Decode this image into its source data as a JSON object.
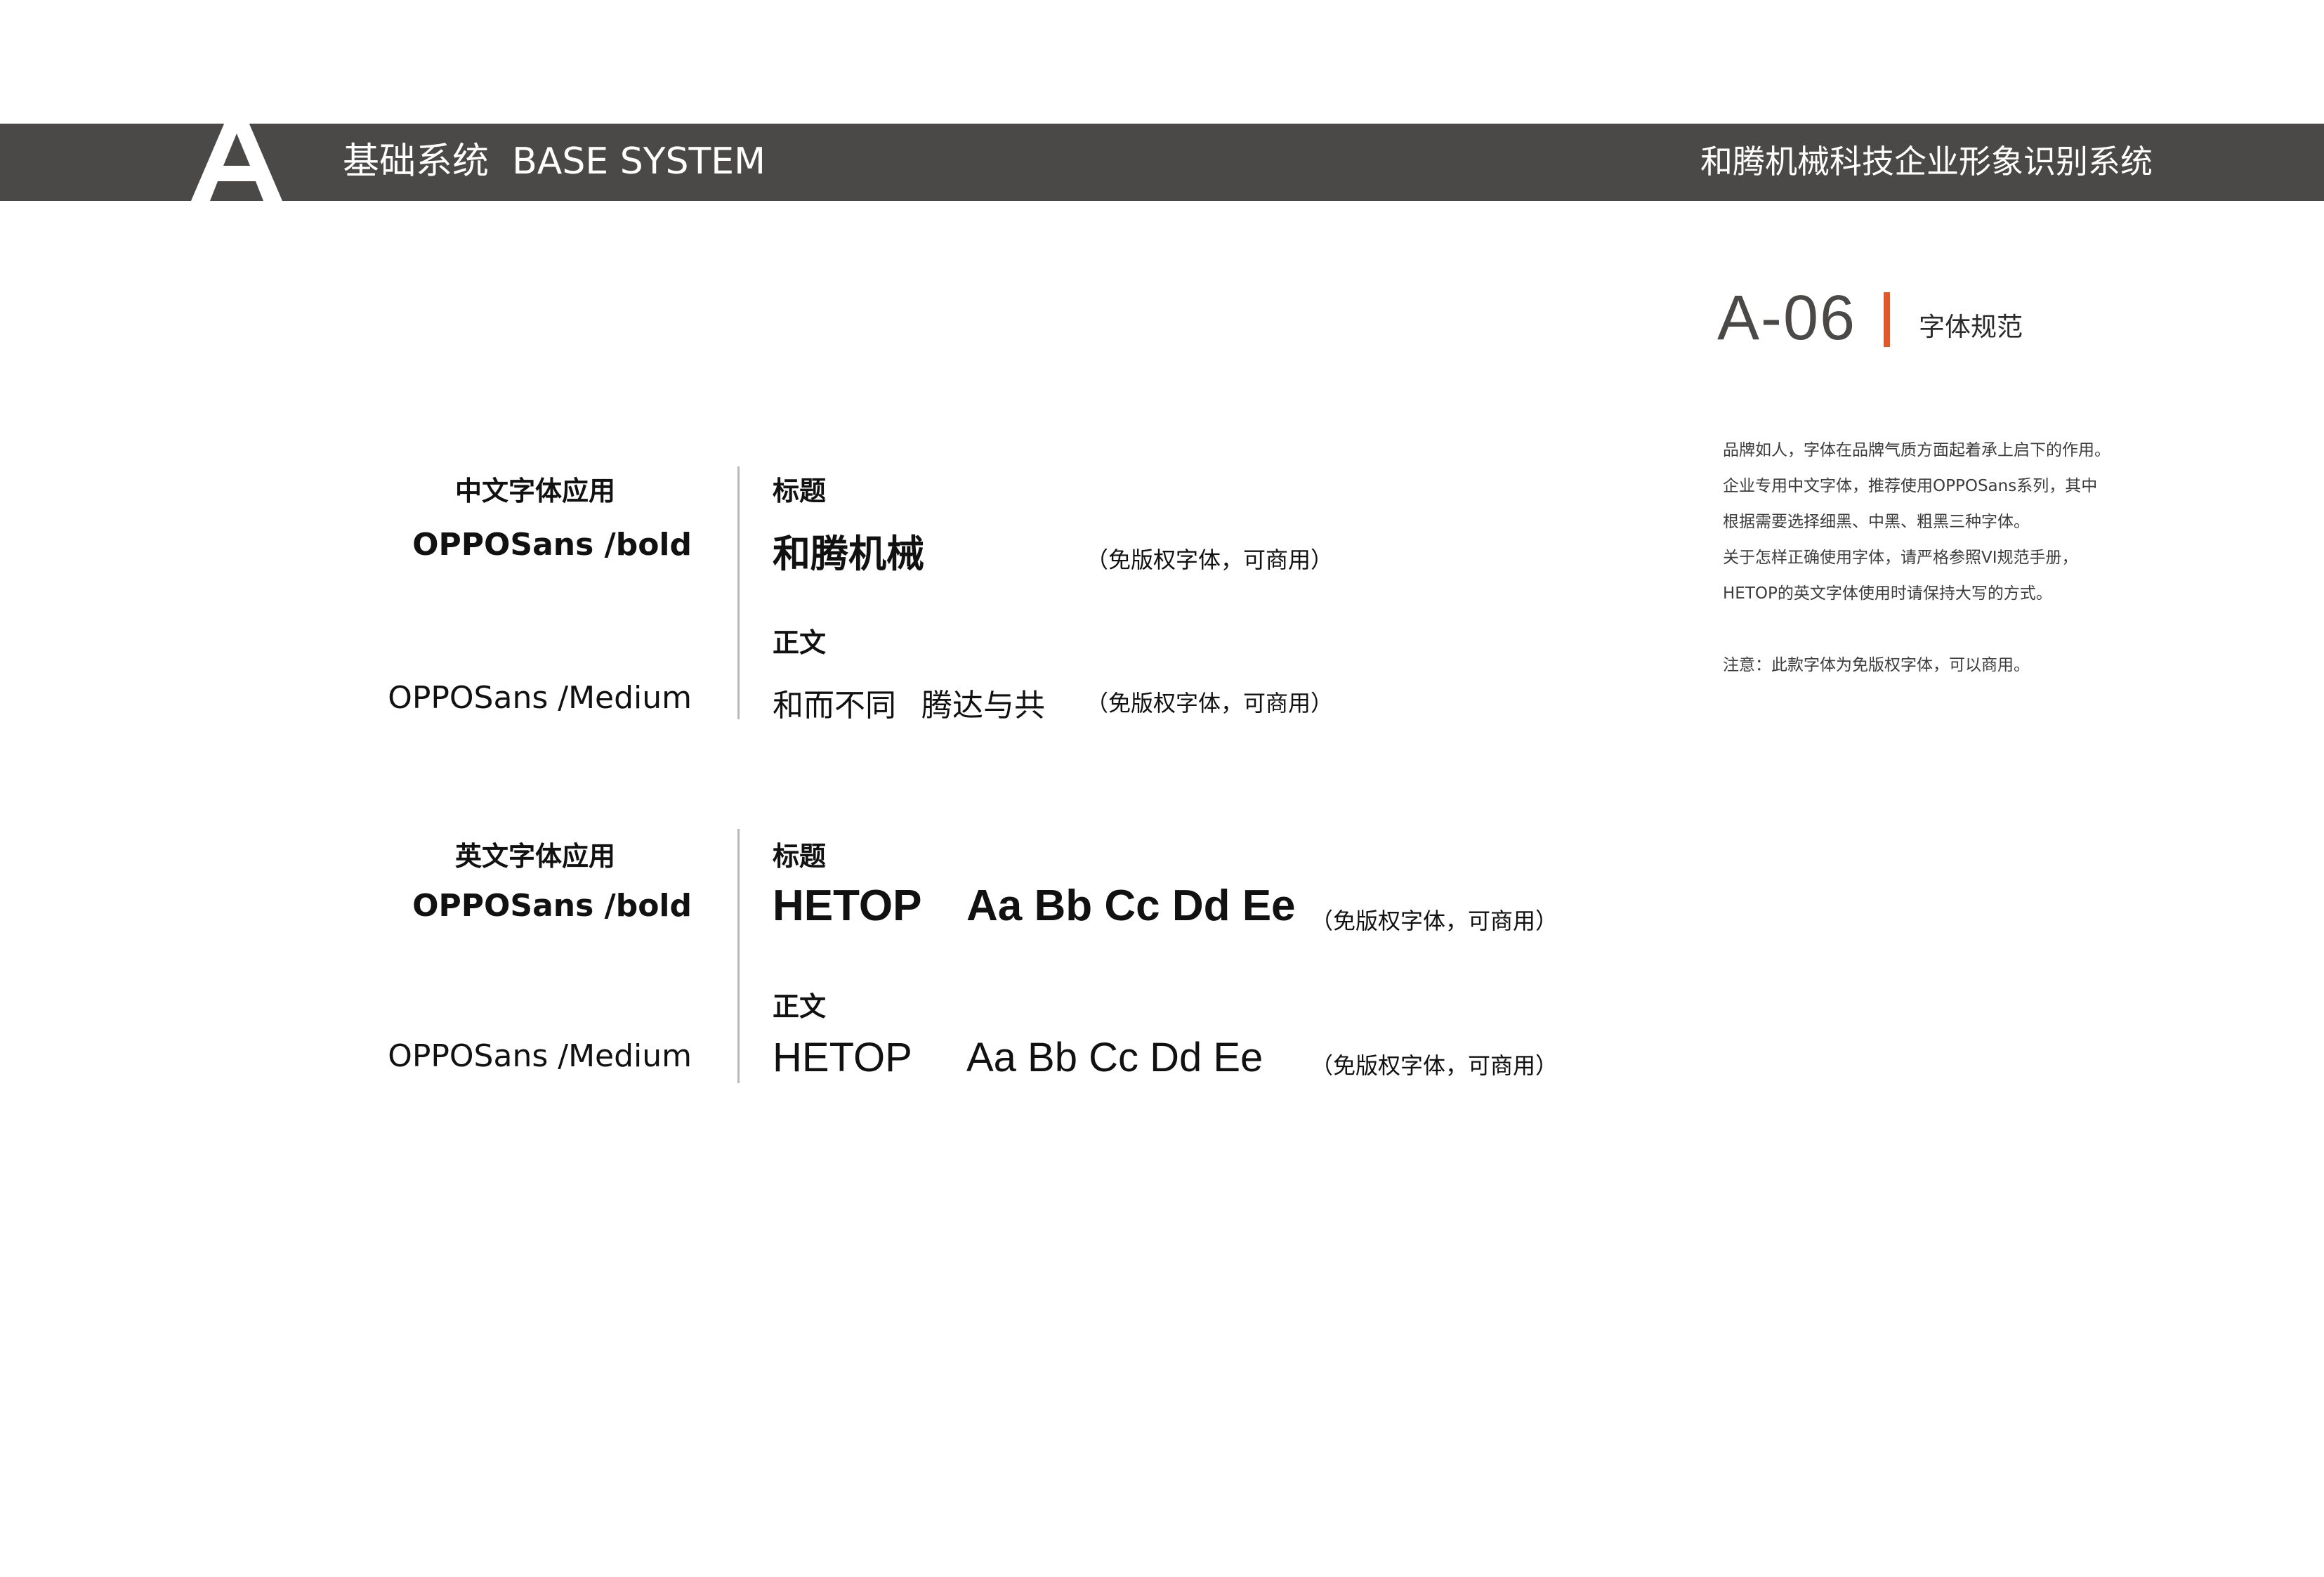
{
  "header": {
    "logo_letter": "A",
    "section_cn": "基础系统",
    "section_en": "BASE SYSTEM",
    "company": "和腾机械科技企业形象识别系统"
  },
  "page": {
    "code": "A-06",
    "topic": "字体规范",
    "accent_color": "#e0582b",
    "bar_color": "#4a4948"
  },
  "description": {
    "lines": [
      "品牌如人，字体在品牌气质方面起着承上启下的作用。",
      "企业专用中文字体，推荐使用OPPOSans系列，其中",
      "根据需要选择细黑、中黑、粗黑三种字体。",
      "关于怎样正确使用字体，请严格参照VI规范手册，",
      "HETOP的英文字体使用时请保持大写的方式。"
    ],
    "note": "注意：此款字体为免版权字体，可以商用。"
  },
  "chinese": {
    "category": "中文字体应用",
    "title_font": "OPPOSans /bold",
    "body_font": "OPPOSans /Medium",
    "title_label": "标题",
    "title_sample": "和腾机械",
    "title_note": "（免版权字体，可商用）",
    "body_label": "正文",
    "body_sample_1": "和而不同",
    "body_sample_2": "腾达与共",
    "body_note": "（免版权字体，可商用）"
  },
  "english": {
    "category": "英文字体应用",
    "title_font": "OPPOSans /bold",
    "body_font": "OPPOSans /Medium",
    "title_label": "标题",
    "title_brand": "HETOP",
    "title_alphabet": "Aa Bb Cc Dd Ee",
    "title_note": "（免版权字体，可商用）",
    "body_label": "正文",
    "body_brand": "HETOP",
    "body_alphabet": "Aa Bb Cc Dd Ee",
    "body_note": "（免版权字体，可商用）"
  }
}
